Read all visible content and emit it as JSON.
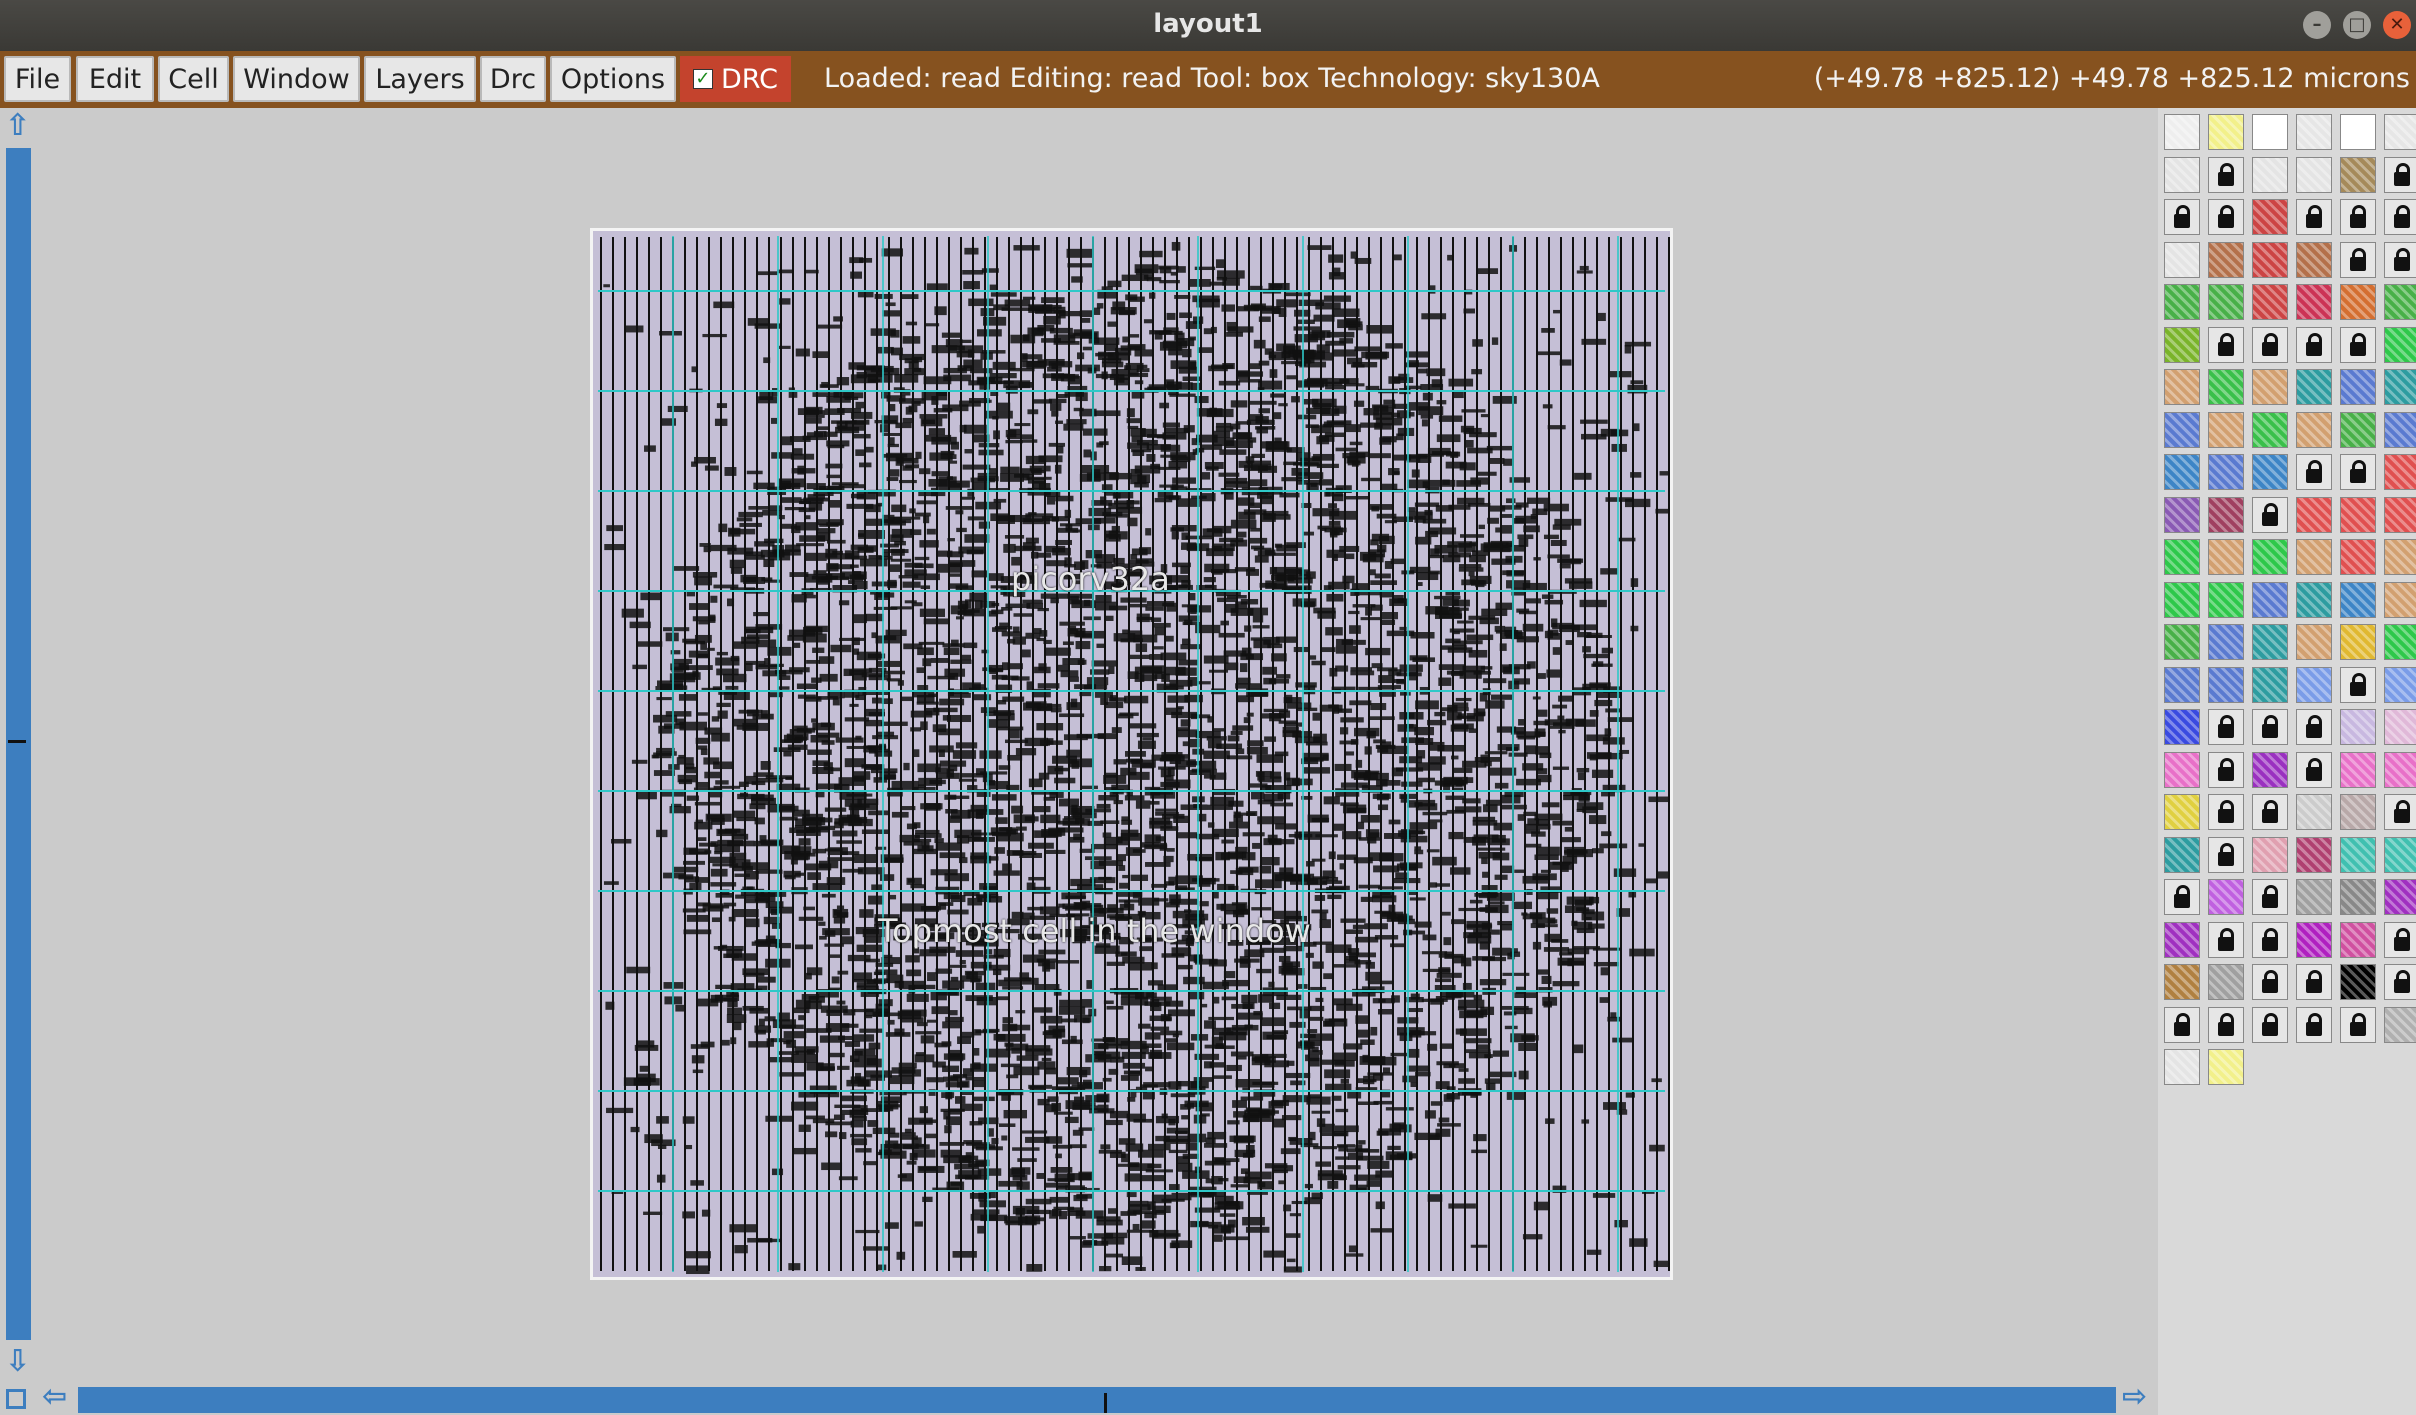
{
  "window": {
    "title": "layout1",
    "controls": [
      "minimize-icon",
      "maximize-icon",
      "close-icon"
    ]
  },
  "menu": {
    "items": [
      "File",
      "Edit",
      "Cell",
      "Window",
      "Layers",
      "Drc",
      "Options"
    ],
    "drc_label": "DRC",
    "drc_checked": true
  },
  "status": {
    "text": "Loaded: read Editing: read Tool: box  Technology: sky130A",
    "coords": "(+49.78 +825.12) +49.78 +825.12 microns"
  },
  "canvas": {
    "cell_name": "picorv32a",
    "cell_caption": "Topmost cell in the window"
  },
  "colors": {
    "menubar": "#86521f",
    "drc_button": "#c4432d",
    "scrollbar": "#3d7ebf",
    "cell_background": "#c5bfd6",
    "routing_grid": "#2ec8c8"
  },
  "palette": {
    "rows": [
      [
        "#eeeeee",
        "#f2f08a",
        "#ffffff",
        "#e6e6e6",
        "#ffffff",
        "#e6e6e6"
      ],
      [
        "#e4e4e4",
        "lock",
        "#e4e4e4",
        "#e4e4e4",
        "#a58a5a",
        "lock"
      ],
      [
        "lock",
        "lock",
        "#cc4444",
        "lock",
        "lock",
        "lock"
      ],
      [
        "#e4e4e4",
        "#b4704a",
        "#cc4444",
        "#b4704a",
        "lock",
        "lock"
      ],
      [
        "#48b048",
        "#48b048",
        "#cc4444",
        "#cc3355",
        "#d46e30",
        "#48b048"
      ],
      [
        "#7ab42a",
        "lock",
        "lock",
        "lock",
        "lock",
        "#2ec84a"
      ],
      [
        "#d2a070",
        "#3ac04a",
        "#d2a070",
        "#2d9ca0",
        "#5a7ad0",
        "#2d9ca0"
      ],
      [
        "#5a7ad0",
        "#d2a070",
        "#3ac04a",
        "#d2a070",
        "#48b048",
        "#5a7ad0"
      ],
      [
        "#3d85c6",
        "#5a7ad0",
        "#3d85c6",
        "lock",
        "lock",
        "#e05050"
      ],
      [
        "#8a5ab4",
        "#a04060",
        "lock",
        "#e05050",
        "#e05050",
        "#e05050"
      ],
      [
        "#2ec84a",
        "#d2a070",
        "#2ec84a",
        "#d2a070",
        "#e05050",
        "#d2a070"
      ],
      [
        "#2ec84a",
        "#2ec84a",
        "#5a7ad0",
        "#2d9ca0",
        "#3d85c6",
        "#d2a070"
      ],
      [
        "#48b048",
        "#5a7ad0",
        "#2d9ca0",
        "#d2a070",
        "#e0b830",
        "#2ec84a"
      ],
      [
        "#5a7ad0",
        "#5a7ad0",
        "#2d9ca0",
        "#7a9ce8",
        "lock",
        "#7a9ce8"
      ],
      [
        "#3a4ae0",
        "lock",
        "lock",
        "lock",
        "#c8b8e0",
        "#e0b8d8"
      ],
      [
        "#e870c8",
        "lock",
        "#9a30c0",
        "lock",
        "#e870c8",
        "#e870c8"
      ],
      [
        "#e0d040",
        "lock",
        "lock",
        "#cccccc",
        "#b8a8a8",
        "lock"
      ],
      [
        "#2d9ca0",
        "lock",
        "#e0a0b0",
        "#b04070",
        "#40c0b0",
        "#40c0b0"
      ],
      [
        "lock",
        "#c060e0",
        "lock",
        "#a0a0a0",
        "#888888",
        "#a030c0"
      ],
      [
        "#a030c0",
        "lock",
        "lock",
        "#b020c0",
        "#d050a0",
        "lock"
      ],
      [
        "#b08040",
        "#a0a0a0",
        "lock",
        "lock",
        "#000000",
        "lock"
      ],
      [
        "lock",
        "lock",
        "lock",
        "lock",
        "lock",
        "#b0b0b0"
      ],
      [
        "#e4e4e4",
        "#f2f08a"
      ]
    ]
  }
}
